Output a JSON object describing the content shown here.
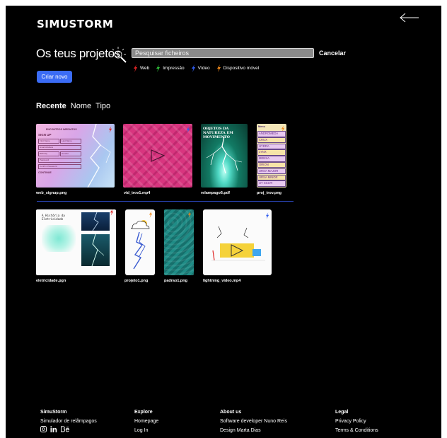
{
  "header": {
    "logo": "SIMUSTORM"
  },
  "main": {
    "title": "Os teus projetos",
    "search_placeholder": "Pesquisar ficheiros",
    "cancel_label": "Cancelar",
    "legend": [
      {
        "label": "Web",
        "color": "#e02424",
        "icon": "lightning-icon"
      },
      {
        "label": "Impressão",
        "color": "#2fbd3a",
        "icon": "lightning-icon"
      },
      {
        "label": "Vídeo",
        "color": "#2f5cf0",
        "icon": "lightning-icon"
      },
      {
        "label": "Dispositivo móvel",
        "color": "#f08a1c",
        "icon": "lightning-icon"
      }
    ],
    "create_label": "Criar novo",
    "sort": [
      {
        "label": "Recente",
        "active": true
      },
      {
        "label": "Nome",
        "active": false
      },
      {
        "label": "Tipo",
        "active": false
      }
    ]
  },
  "projects": [
    {
      "name": "web_signup.png",
      "type": "Web"
    },
    {
      "name": "vid_trov1.mp4",
      "type": "Vídeo"
    },
    {
      "name": "relampago6.pdf",
      "type": "Impressão"
    },
    {
      "name": "proj_trov.png",
      "type": "Dispositivo móvel"
    },
    {
      "name": "eletricidade.pgn",
      "type": "Web"
    },
    {
      "name": "projeto1.png",
      "type": "Dispositivo móvel"
    },
    {
      "name": "padrao1.png",
      "type": "Dispositivo móvel"
    },
    {
      "name": "lightning_video.mp4",
      "type": "Vídeo"
    }
  ],
  "thumbs": {
    "signup": {
      "brand": "ENCONTROS IMEDIATOS",
      "heading": "SIGN UP",
      "first_name": "First Name",
      "last_name": "Last Name",
      "email": "Email Address",
      "birthday": "Birthday",
      "gender": "Gender",
      "password": "Password",
      "confirm": "Confirm Password",
      "continue": "CONTINUE"
    },
    "pdf_title": "OBJETOS DA NATUREZA EM MOVIMENTO",
    "mobile_menu": {
      "title": "Menu",
      "items": [
        "ANDROMEDA",
        "CRUX",
        "HYDRA",
        "LYNX",
        "MENSA",
        "ORION",
        "URSA MAJOR",
        "URSA MINOR",
        "UY SCUTI"
      ]
    },
    "eletricidade_title": "A História da Eletricidade"
  },
  "footer": {
    "columns": [
      {
        "heading": "SimuStorm",
        "lines": [
          "Simulador de relâmpagos"
        ]
      },
      {
        "heading": "Explore",
        "lines": [
          "Homepage",
          "Log In"
        ]
      },
      {
        "heading": "About us",
        "lines": [
          "Software developer Nuno Reis",
          "Design Marta Dias"
        ]
      },
      {
        "heading": "Legal",
        "lines": [
          "Privacy Policy",
          "Terms & Conditions"
        ]
      }
    ],
    "social": [
      "instagram-icon",
      "linkedin-icon",
      "behance-icon"
    ]
  }
}
